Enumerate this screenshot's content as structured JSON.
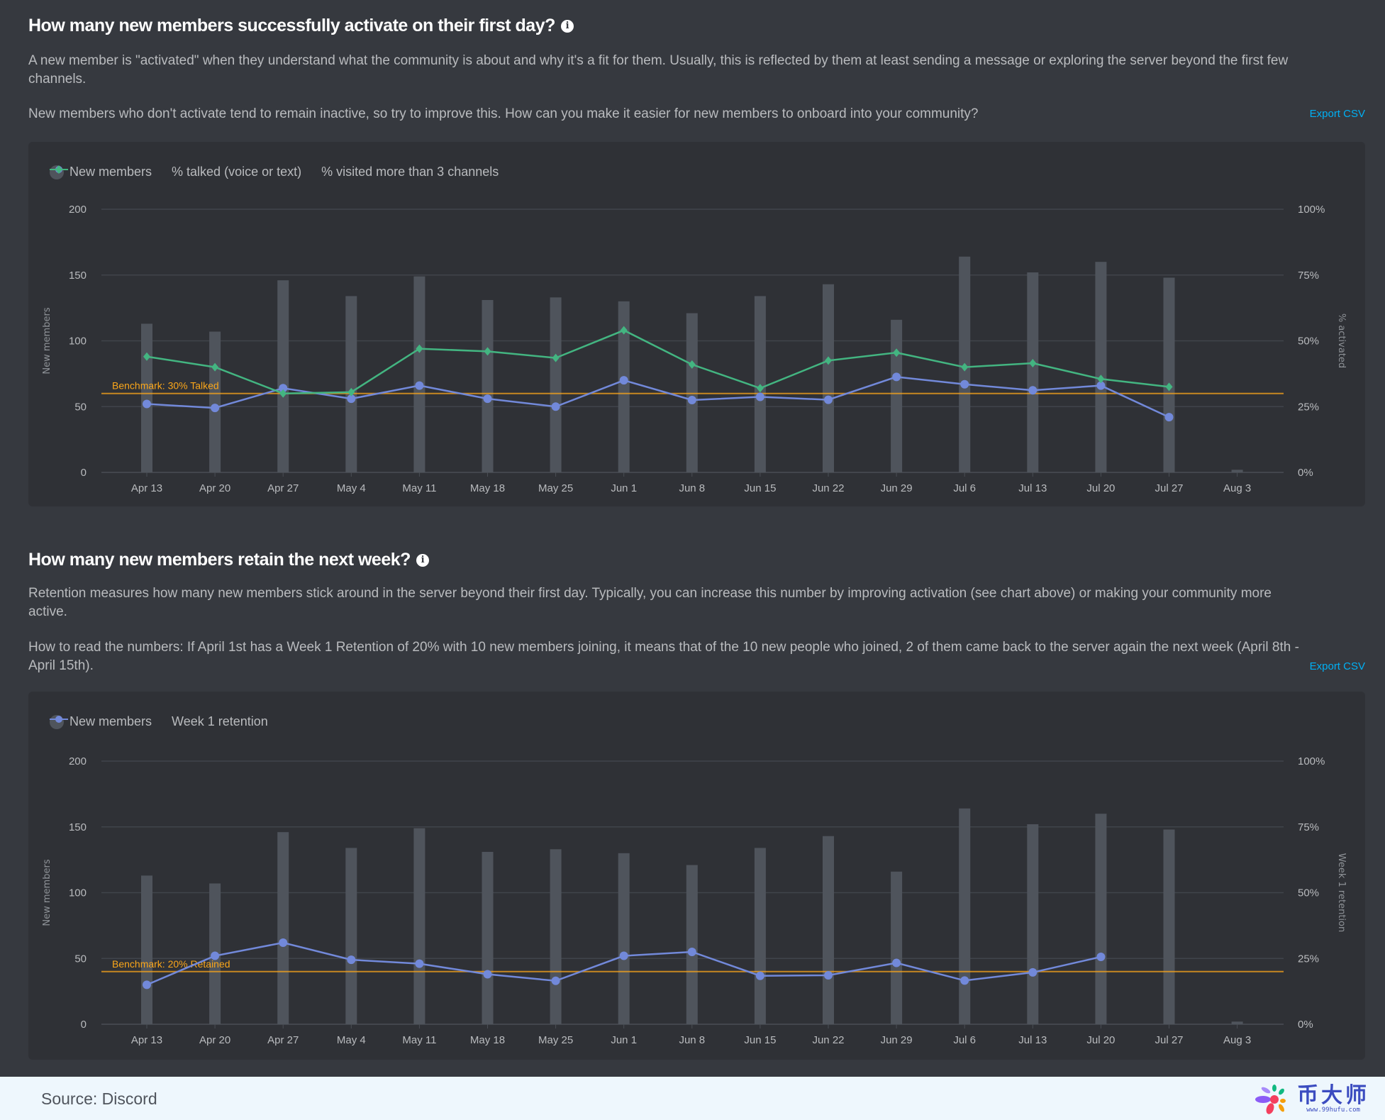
{
  "sections": [
    {
      "title": "How many new members successfully activate on their first day?",
      "info_icon": "info-icon",
      "paragraphs": [
        "A new member is \"activated\" when they understand what the community is about and why it's a fit for them. Usually, this is reflected by them at least sending a message or exploring the server beyond the first few channels.",
        "New members who don't activate tend to remain inactive, so try to improve this. How can you make it easier for new members to onboard into your community?"
      ],
      "export_label": "Export CSV"
    },
    {
      "title": "How many new members retain the next week?",
      "info_icon": "info-icon",
      "paragraphs": [
        "Retention measures how many new members stick around in the server beyond their first day. Typically, you can increase this number by improving activation (see chart above) or making your community more active.",
        "How to read the numbers: If April 1st has a Week 1 Retention of 20% with 10 new members joining, it means that of the 10 new people who joined, 2 of them came back to the server again the next week (April 8th - April 15th)."
      ],
      "export_label": "Export CSV"
    }
  ],
  "colors": {
    "bars": "#4f545c",
    "talked": "#7289da",
    "visited": "#43b581",
    "benchmark": "#faa61a",
    "gridline": "#40444b",
    "export_link": "#00b0f4"
  },
  "chart_data": [
    {
      "type": "bar",
      "title": "How many new members successfully activate on their first day?",
      "categories": [
        "Apr 13",
        "Apr 20",
        "Apr 27",
        "May 4",
        "May 11",
        "May 18",
        "May 25",
        "Jun 1",
        "Jun 8",
        "Jun 15",
        "Jun 22",
        "Jun 29",
        "Jul 6",
        "Jul 13",
        "Jul 20",
        "Jul 27",
        "Aug 3"
      ],
      "ylabel": "New members",
      "ylabel_right": "% activated",
      "ylim": [
        0,
        200
      ],
      "yticks": [
        "0",
        "50",
        "100",
        "150",
        "200"
      ],
      "ylim_right": [
        0,
        100
      ],
      "yticks_right": [
        "0%",
        "25%",
        "50%",
        "75%",
        "100%"
      ],
      "legend_position": "top-left",
      "grid": true,
      "series": [
        {
          "name": "New members",
          "kind": "bar",
          "axis": "left",
          "values": [
            113,
            107,
            146,
            134,
            149,
            131,
            133,
            130,
            121,
            134,
            143,
            116,
            164,
            152,
            160,
            148,
            2
          ]
        },
        {
          "name": "% talked (voice or text)",
          "kind": "line",
          "axis": "right",
          "marker": "circle",
          "values": [
            26,
            24.5,
            32,
            28,
            33,
            28,
            25,
            35,
            27.5,
            28.7,
            27.6,
            36.3,
            33.5,
            31.2,
            33,
            21,
            null
          ]
        },
        {
          "name": "% visited more than 3 channels",
          "kind": "line",
          "axis": "right",
          "marker": "diamond",
          "values": [
            44,
            40,
            30,
            30.5,
            47,
            46,
            43.5,
            54,
            41,
            32,
            42.5,
            45.5,
            40,
            41.5,
            35.5,
            32.5,
            null
          ]
        }
      ],
      "benchmark": {
        "label": "Benchmark: 30% Talked",
        "value": 30,
        "axis": "right"
      }
    },
    {
      "type": "bar",
      "title": "How many new members retain the next week?",
      "categories": [
        "Apr 13",
        "Apr 20",
        "Apr 27",
        "May 4",
        "May 11",
        "May 18",
        "May 25",
        "Jun 1",
        "Jun 8",
        "Jun 15",
        "Jun 22",
        "Jun 29",
        "Jul 6",
        "Jul 13",
        "Jul 20",
        "Jul 27",
        "Aug 3"
      ],
      "ylabel": "New members",
      "ylabel_right": "Week 1 retention",
      "ylim": [
        0,
        200
      ],
      "yticks": [
        "0",
        "50",
        "100",
        "150",
        "200"
      ],
      "ylim_right": [
        0,
        100
      ],
      "yticks_right": [
        "0%",
        "25%",
        "50%",
        "75%",
        "100%"
      ],
      "legend_position": "top-left",
      "grid": true,
      "series": [
        {
          "name": "New members",
          "kind": "bar",
          "axis": "left",
          "values": [
            113,
            107,
            146,
            134,
            149,
            131,
            133,
            130,
            121,
            134,
            143,
            116,
            164,
            152,
            160,
            148,
            2
          ]
        },
        {
          "name": "Week 1 retention",
          "kind": "line",
          "axis": "right",
          "marker": "circle",
          "values": [
            15,
            26,
            31,
            24.5,
            23,
            19,
            16.5,
            26,
            27.5,
            18.4,
            18.6,
            23.3,
            16.6,
            19.7,
            25.6,
            null,
            null
          ]
        }
      ],
      "benchmark": {
        "label": "Benchmark: 20% Retained",
        "value": 20,
        "axis": "right"
      }
    }
  ],
  "footer": {
    "source": "Source: Discord",
    "logo_text": "币大师",
    "logo_url_text": "www.99hufu.com"
  }
}
